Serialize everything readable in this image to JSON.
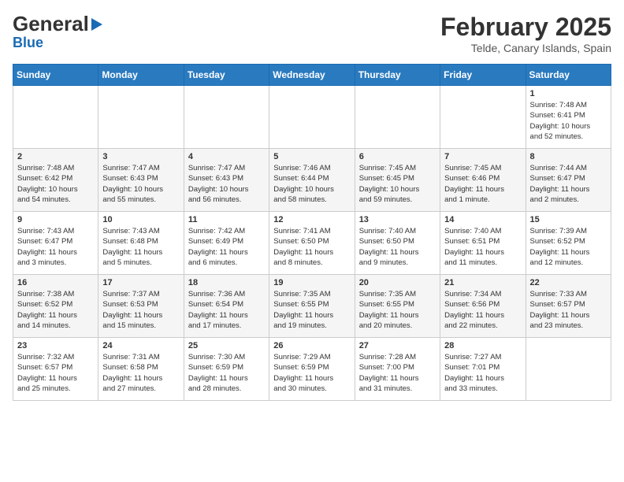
{
  "header": {
    "logo_general": "General",
    "logo_blue": "Blue",
    "month": "February 2025",
    "location": "Telde, Canary Islands, Spain"
  },
  "weekdays": [
    "Sunday",
    "Monday",
    "Tuesday",
    "Wednesday",
    "Thursday",
    "Friday",
    "Saturday"
  ],
  "weeks": [
    [
      {
        "day": "",
        "info": ""
      },
      {
        "day": "",
        "info": ""
      },
      {
        "day": "",
        "info": ""
      },
      {
        "day": "",
        "info": ""
      },
      {
        "day": "",
        "info": ""
      },
      {
        "day": "",
        "info": ""
      },
      {
        "day": "1",
        "info": "Sunrise: 7:48 AM\nSunset: 6:41 PM\nDaylight: 10 hours\nand 52 minutes."
      }
    ],
    [
      {
        "day": "2",
        "info": "Sunrise: 7:48 AM\nSunset: 6:42 PM\nDaylight: 10 hours\nand 54 minutes."
      },
      {
        "day": "3",
        "info": "Sunrise: 7:47 AM\nSunset: 6:43 PM\nDaylight: 10 hours\nand 55 minutes."
      },
      {
        "day": "4",
        "info": "Sunrise: 7:47 AM\nSunset: 6:43 PM\nDaylight: 10 hours\nand 56 minutes."
      },
      {
        "day": "5",
        "info": "Sunrise: 7:46 AM\nSunset: 6:44 PM\nDaylight: 10 hours\nand 58 minutes."
      },
      {
        "day": "6",
        "info": "Sunrise: 7:45 AM\nSunset: 6:45 PM\nDaylight: 10 hours\nand 59 minutes."
      },
      {
        "day": "7",
        "info": "Sunrise: 7:45 AM\nSunset: 6:46 PM\nDaylight: 11 hours\nand 1 minute."
      },
      {
        "day": "8",
        "info": "Sunrise: 7:44 AM\nSunset: 6:47 PM\nDaylight: 11 hours\nand 2 minutes."
      }
    ],
    [
      {
        "day": "9",
        "info": "Sunrise: 7:43 AM\nSunset: 6:47 PM\nDaylight: 11 hours\nand 3 minutes."
      },
      {
        "day": "10",
        "info": "Sunrise: 7:43 AM\nSunset: 6:48 PM\nDaylight: 11 hours\nand 5 minutes."
      },
      {
        "day": "11",
        "info": "Sunrise: 7:42 AM\nSunset: 6:49 PM\nDaylight: 11 hours\nand 6 minutes."
      },
      {
        "day": "12",
        "info": "Sunrise: 7:41 AM\nSunset: 6:50 PM\nDaylight: 11 hours\nand 8 minutes."
      },
      {
        "day": "13",
        "info": "Sunrise: 7:40 AM\nSunset: 6:50 PM\nDaylight: 11 hours\nand 9 minutes."
      },
      {
        "day": "14",
        "info": "Sunrise: 7:40 AM\nSunset: 6:51 PM\nDaylight: 11 hours\nand 11 minutes."
      },
      {
        "day": "15",
        "info": "Sunrise: 7:39 AM\nSunset: 6:52 PM\nDaylight: 11 hours\nand 12 minutes."
      }
    ],
    [
      {
        "day": "16",
        "info": "Sunrise: 7:38 AM\nSunset: 6:52 PM\nDaylight: 11 hours\nand 14 minutes."
      },
      {
        "day": "17",
        "info": "Sunrise: 7:37 AM\nSunset: 6:53 PM\nDaylight: 11 hours\nand 15 minutes."
      },
      {
        "day": "18",
        "info": "Sunrise: 7:36 AM\nSunset: 6:54 PM\nDaylight: 11 hours\nand 17 minutes."
      },
      {
        "day": "19",
        "info": "Sunrise: 7:35 AM\nSunset: 6:55 PM\nDaylight: 11 hours\nand 19 minutes."
      },
      {
        "day": "20",
        "info": "Sunrise: 7:35 AM\nSunset: 6:55 PM\nDaylight: 11 hours\nand 20 minutes."
      },
      {
        "day": "21",
        "info": "Sunrise: 7:34 AM\nSunset: 6:56 PM\nDaylight: 11 hours\nand 22 minutes."
      },
      {
        "day": "22",
        "info": "Sunrise: 7:33 AM\nSunset: 6:57 PM\nDaylight: 11 hours\nand 23 minutes."
      }
    ],
    [
      {
        "day": "23",
        "info": "Sunrise: 7:32 AM\nSunset: 6:57 PM\nDaylight: 11 hours\nand 25 minutes."
      },
      {
        "day": "24",
        "info": "Sunrise: 7:31 AM\nSunset: 6:58 PM\nDaylight: 11 hours\nand 27 minutes."
      },
      {
        "day": "25",
        "info": "Sunrise: 7:30 AM\nSunset: 6:59 PM\nDaylight: 11 hours\nand 28 minutes."
      },
      {
        "day": "26",
        "info": "Sunrise: 7:29 AM\nSunset: 6:59 PM\nDaylight: 11 hours\nand 30 minutes."
      },
      {
        "day": "27",
        "info": "Sunrise: 7:28 AM\nSunset: 7:00 PM\nDaylight: 11 hours\nand 31 minutes."
      },
      {
        "day": "28",
        "info": "Sunrise: 7:27 AM\nSunset: 7:01 PM\nDaylight: 11 hours\nand 33 minutes."
      },
      {
        "day": "",
        "info": ""
      }
    ]
  ]
}
